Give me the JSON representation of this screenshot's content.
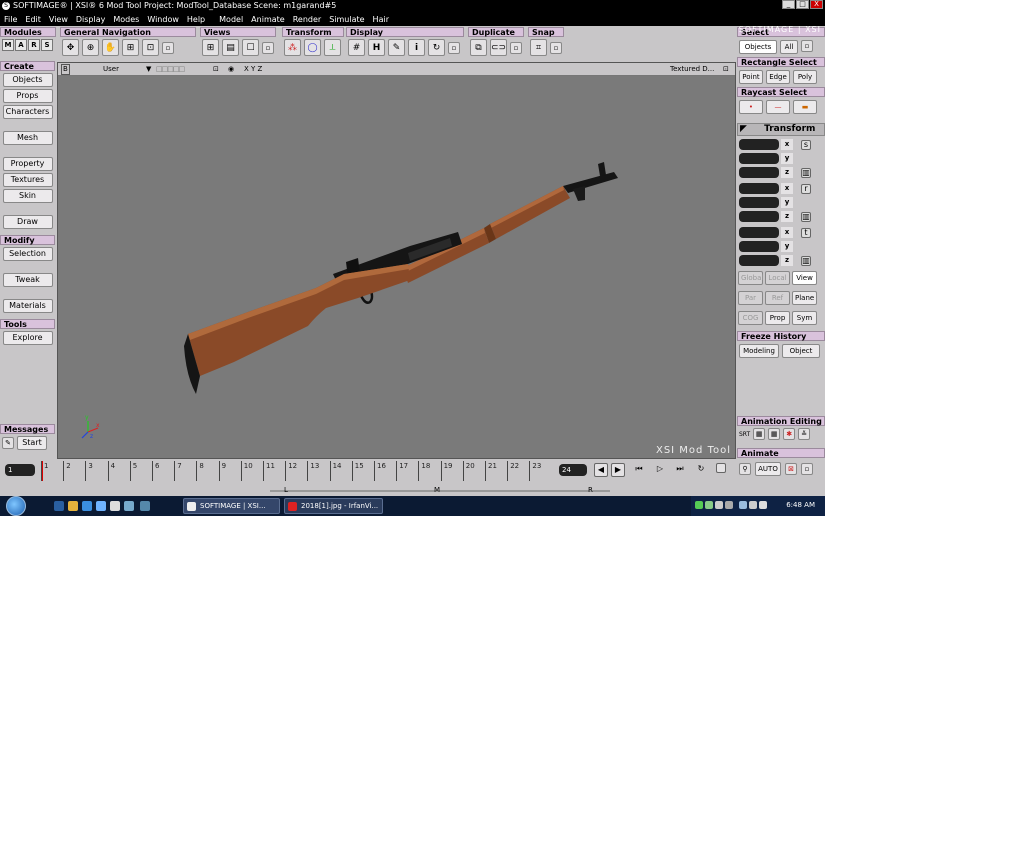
{
  "title": {
    "text": "SOFTIMAGE® | XSI® 6 Mod Tool Project: ModTool_Database   Scene: m1garand#5",
    "brand": "SOFTIMAGE | XSI",
    "minimize": "_",
    "maximize": "□",
    "close": "X"
  },
  "menu": [
    "File",
    "Edit",
    "View",
    "Display",
    "Modes",
    "Window",
    "Help",
    "Model",
    "Animate",
    "Render",
    "Simulate",
    "Hair"
  ],
  "toolbar": {
    "modules": {
      "label": "Modules",
      "buttons": [
        "M",
        "A",
        "R",
        "S"
      ]
    },
    "general_navigation": {
      "label": "General Navigation"
    },
    "views": {
      "label": "Views"
    },
    "transform": {
      "label": "Transform"
    },
    "display": {
      "label": "Display",
      "hide": "H",
      "info": "i"
    },
    "duplicate": {
      "label": "Duplicate"
    },
    "snap": {
      "label": "Snap"
    }
  },
  "left_panel": {
    "create": {
      "header": "Create",
      "buttons": [
        "Objects",
        "Props",
        "Characters",
        "Mesh",
        "Property",
        "Textures",
        "Skin",
        "Draw"
      ]
    },
    "modify": {
      "header": "Modify",
      "buttons": [
        "Selection",
        "Tweak",
        "Materials"
      ]
    },
    "tools": {
      "header": "Tools",
      "buttons": [
        "Explore"
      ]
    },
    "messages": {
      "header": "Messages",
      "start": "Start"
    }
  },
  "viewport": {
    "label": "B",
    "camera": "User",
    "axes": "X Y Z",
    "mode": "Textured D...",
    "watermark": "XSI Mod Tool",
    "axis_x": "x",
    "axis_y": "y",
    "axis_z": "z"
  },
  "right_panel": {
    "select": {
      "header": "Select",
      "objects": "Objects",
      "all": "All"
    },
    "rectangle_select": {
      "header": "Rectangle Select",
      "buttons": [
        "Point",
        "Edge",
        "Poly"
      ]
    },
    "raycast_select": {
      "header": "Raycast Select"
    },
    "transform": {
      "header": "Transform",
      "groups": [
        {
          "icon": "s",
          "axes": [
            "x",
            "y",
            "z"
          ]
        },
        {
          "icon": "r",
          "axes": [
            "x",
            "y",
            "z"
          ]
        },
        {
          "icon": "t",
          "axes": [
            "x",
            "y",
            "z"
          ]
        }
      ],
      "space": [
        "Global",
        "Local",
        "View"
      ],
      "ref": [
        "Par",
        "Ref",
        "Plane"
      ],
      "misc": [
        "COG",
        "Prop",
        "Sym"
      ]
    },
    "freeze_history": {
      "header": "Freeze History",
      "modeling": "Modeling",
      "object": "Object"
    },
    "animation_editing": {
      "header": "Animation Editing",
      "srt": "SRT"
    },
    "animate": {
      "header": "Animate",
      "auto": "AUTO"
    }
  },
  "timeline": {
    "start_frame": "1",
    "end_frame": "24",
    "ticks": [
      "1",
      "2",
      "3",
      "4",
      "5",
      "6",
      "7",
      "8",
      "9",
      "10",
      "11",
      "12",
      "13",
      "14",
      "15",
      "16",
      "17",
      "18",
      "19",
      "20",
      "21",
      "22",
      "23"
    ],
    "range_markers": [
      "L",
      "M",
      "R"
    ]
  },
  "taskbar": {
    "tasks": [
      "SOFTIMAGE | XSI...",
      "2018[1].jpg - IrfanVi..."
    ],
    "clock": "6:48 AM"
  },
  "colors": {
    "panel_bg": "#c8c6c8",
    "header_bg": "#d9c2dc",
    "viewport_bg": "#7a7a7a",
    "wood": "#8a4a28",
    "metal": "#1a1a1a"
  }
}
